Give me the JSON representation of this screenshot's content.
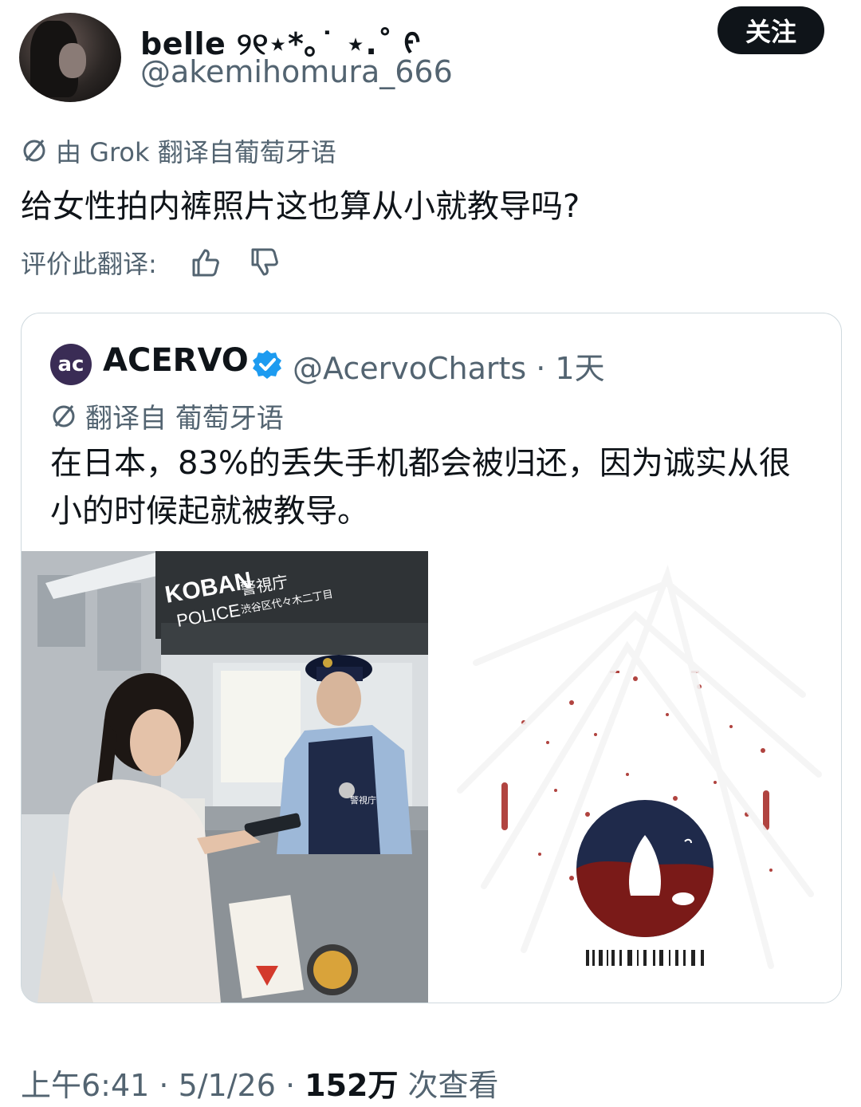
{
  "author": {
    "display_name": "belle ୨୧⋆*｡˙ ⋆.˚ ᠻ",
    "handle": "@akemihomura_666",
    "follow_label": "关注"
  },
  "translation_note": "由 Grok 翻译自葡萄牙语",
  "tweet_text": "给女性拍内裤照片这也算从小就教导吗?",
  "rate_label": "评价此翻译:",
  "quoted": {
    "logo_text": "ac",
    "name": "ACERVO",
    "handle_time": "@AcervoCharts · 1天",
    "translation_note": "翻译自 葡萄牙语",
    "text": "在日本，83%的丢失手机都会被归还，因为诚实从很小的时候起就被教导。",
    "photo_sign_top": "KOBAN",
    "photo_sign_bottom": "POLICE",
    "photo_sign_jp": "警視庁",
    "photo_sign_jp_sub": "渋谷区代々木二丁目",
    "patch_text": "警視庁"
  },
  "footer": {
    "time": "上午6:41 · 5/1/26 · ",
    "views_count": "152万",
    "views_label": " 次查看"
  },
  "colors": {
    "text_primary": "#0f1419",
    "text_secondary": "#536471",
    "verified_blue": "#1d9bf0",
    "logo_navy": "#1f2a4b",
    "logo_red": "#7a1a18"
  }
}
